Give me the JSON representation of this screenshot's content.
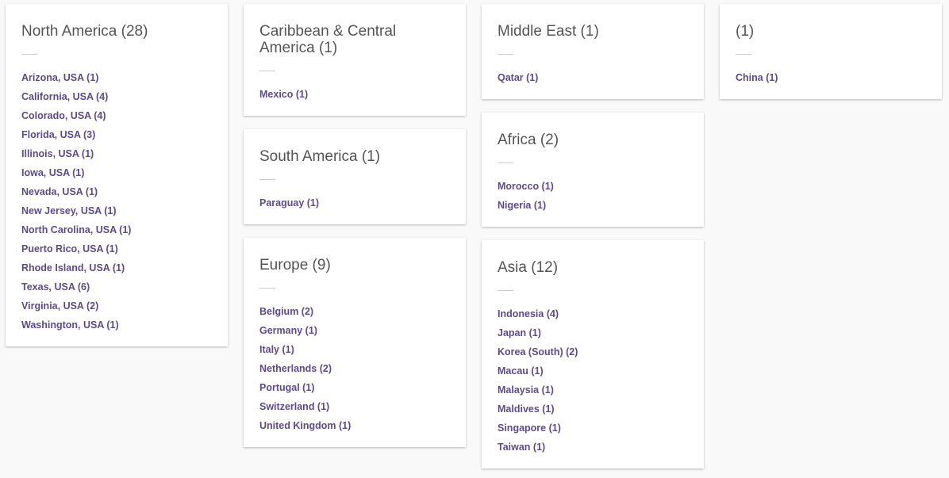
{
  "colors": {
    "background": "#f9f9f9",
    "card": "#ffffff",
    "title": "#555555",
    "link": "#5e4a8c",
    "divider": "#cccccc"
  },
  "columns": [
    {
      "cards": [
        {
          "title": "North America (28)",
          "items": [
            "Arizona, USA (1)",
            "California, USA (4)",
            "Colorado, USA (4)",
            "Florida, USA (3)",
            "Illinois, USA (1)",
            "Iowa, USA (1)",
            "Nevada, USA (1)",
            "New Jersey, USA (1)",
            "North Carolina, USA (1)",
            "Puerto Rico, USA (1)",
            "Rhode Island, USA (1)",
            "Texas, USA (6)",
            "Virginia, USA (2)",
            "Washington, USA (1)"
          ]
        }
      ]
    },
    {
      "cards": [
        {
          "title": "Caribbean & Central America (1)",
          "items": [
            "Mexico (1)"
          ]
        },
        {
          "title": "South America (1)",
          "items": [
            "Paraguay (1)"
          ]
        },
        {
          "title": "Europe (9)",
          "items": [
            "Belgium (2)",
            "Germany (1)",
            "Italy (1)",
            "Netherlands (2)",
            "Portugal (1)",
            "Switzerland (1)",
            "United Kingdom (1)"
          ]
        }
      ]
    },
    {
      "cards": [
        {
          "title": "Middle East (1)",
          "items": [
            "Qatar (1)"
          ]
        },
        {
          "title": "Africa (2)",
          "items": [
            "Morocco (1)",
            "Nigeria (1)"
          ]
        },
        {
          "title": "Asia (12)",
          "items": [
            "Indonesia (4)",
            "Japan (1)",
            "Korea (South) (2)",
            "Macau (1)",
            "Malaysia (1)",
            "Maldives (1)",
            "Singapore (1)",
            "Taiwan (1)"
          ]
        }
      ]
    },
    {
      "cards": [
        {
          "title": "(1)",
          "items": [
            "China (1)"
          ]
        }
      ]
    }
  ]
}
